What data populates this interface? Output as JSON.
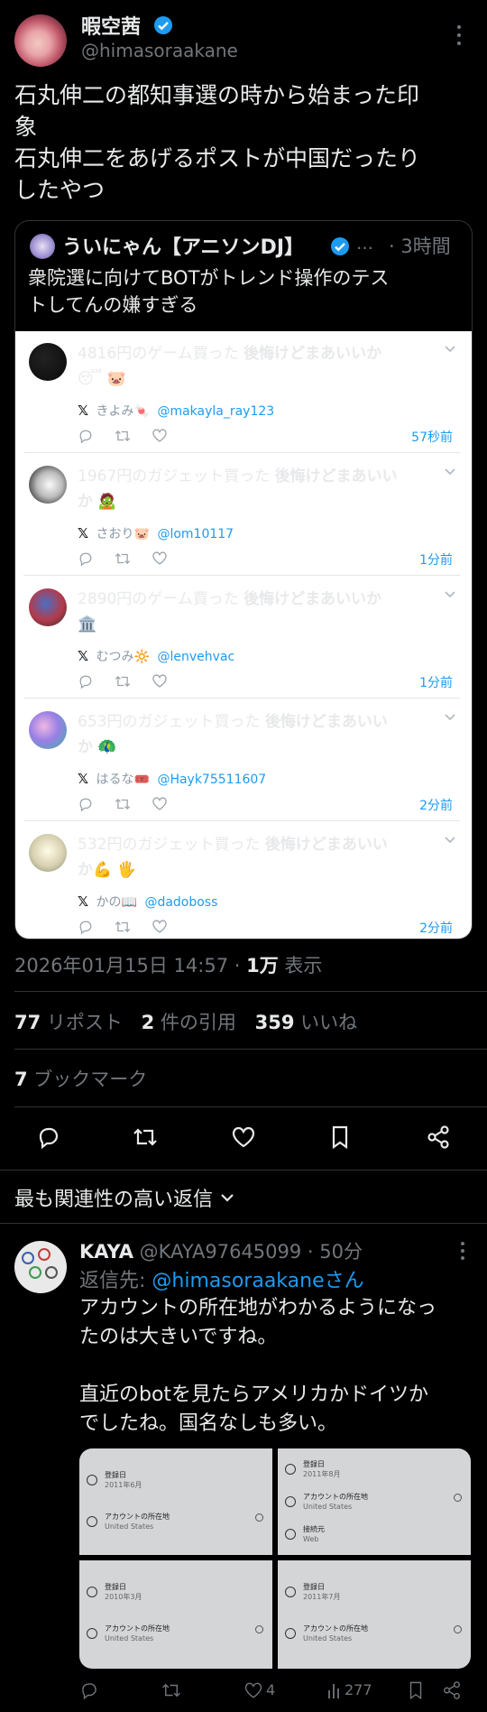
{
  "post": {
    "display_name": "暇空茜",
    "handle": "@himasoraakane",
    "text_lines": [
      "石丸伸二の都知事選の時から始まった印",
      "象",
      "石丸伸二をあげるポストが中国だったり",
      "したやつ"
    ]
  },
  "quote": {
    "name": "ういにゃん【アニソンDJ】",
    "dots": "…",
    "time": "· 3時間",
    "text_lines": [
      "衆院選に向けてBOTがトレンド操作のテス",
      "トしてんの嫌すぎる"
    ]
  },
  "embedded": [
    {
      "line1": "4816円のゲーム買った ",
      "bold1": "後悔けどまあいいか",
      "line2": "😴 🐷",
      "name": "きよみ🍬",
      "handle": "@makayla_ray123",
      "time": "57秒前"
    },
    {
      "line1": "1967円のガジェット買った ",
      "bold1": "後悔けどまあいい",
      "line2b": "か",
      "line2": " 🧟",
      "name": "さおり🐷",
      "handle": "@lom10117",
      "time": "1分前"
    },
    {
      "line1": "2890円のゲーム買った ",
      "bold1": "後悔けどまあいいか",
      "line2": "🏛️",
      "name": "むつみ🔆",
      "handle": "@lenvehvac",
      "time": "1分前"
    },
    {
      "line1": "653円のガジェット買った ",
      "bold1": "後悔けどまあいい",
      "line2b": "か",
      "line2": " 🦚",
      "name": "はるな🎟️",
      "handle": "@Hayk75511607",
      "time": "2分前"
    },
    {
      "line1": "532円のガジェット買った ",
      "bold1": "後悔けどまあいい",
      "line2b": "か",
      "line2": "💪 🖐️",
      "name": "かの📖",
      "handle": "@dadoboss",
      "time": "2分前"
    }
  ],
  "meta": {
    "date": "2026年01月15日 14:57 · ",
    "views_num": "1万",
    "views_label": " 表示"
  },
  "stats": {
    "reposts_num": "77",
    "reposts_label": " リポスト",
    "quotes_num": "2",
    "quotes_label": " 件の引用",
    "likes_num": "359",
    "likes_label": " いいね",
    "bookmarks_num": "7",
    "bookmarks_label": " ブックマーク"
  },
  "replies_header": "最も関連性の高い返信",
  "reply": {
    "name": "KAYA",
    "handle": "@KAYA97645099 · 50分",
    "reply_to_label": "返信先: ",
    "reply_to": "@himasoraakaneさん",
    "text_lines": [
      "アカウントの所在地がわかるようになっ",
      "たのは大きいですね。",
      "",
      "直近のbotを見たらアメリカかドイツか",
      "でしたね。国名なしも多い。"
    ],
    "images": [
      {
        "rows": [
          [
            "登録日",
            "2011年6月"
          ],
          [
            "アカウントの所在地",
            "United States"
          ]
        ]
      },
      {
        "rows": [
          [
            "登録日",
            "2011年8月"
          ],
          [
            "アカウントの所在地",
            "United States"
          ],
          [
            "接続元",
            "Web"
          ]
        ]
      },
      {
        "rows": [
          [
            "登録日",
            "2010年3月"
          ],
          [
            "アカウントの所在地",
            "United States"
          ]
        ]
      },
      {
        "rows": [
          [
            "登録日",
            "2011年7月"
          ],
          [
            "アカウントの所在地",
            "United States"
          ]
        ]
      }
    ],
    "likes": "4",
    "views": "277"
  },
  "colors": {
    "accent": "#1d9bf0",
    "background": "#000000",
    "muted": "#71767b"
  }
}
